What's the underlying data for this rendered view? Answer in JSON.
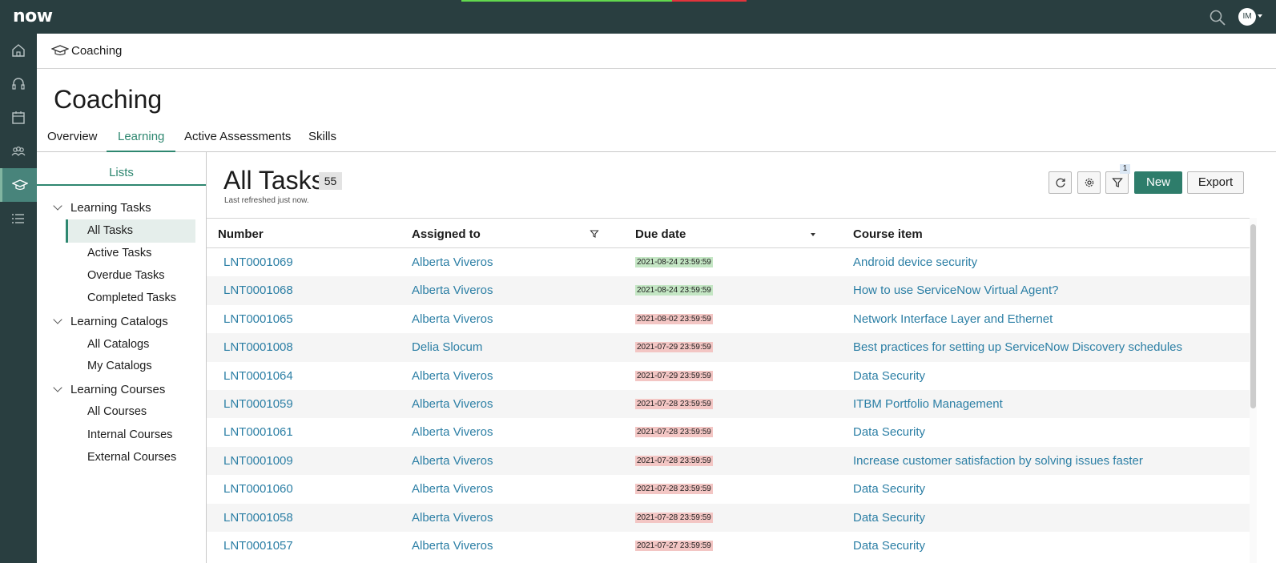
{
  "header": {
    "logo_text": "now",
    "avatar_initials": "IM",
    "progress_colors": {
      "ok": "#62d84e",
      "warn": "#e2343c"
    }
  },
  "rail": {
    "items": [
      {
        "icon": "home-icon"
      },
      {
        "icon": "headset-icon"
      },
      {
        "icon": "calendar-icon"
      },
      {
        "icon": "team-icon"
      },
      {
        "icon": "graduation-cap-icon",
        "active": true
      },
      {
        "icon": "list-icon"
      }
    ]
  },
  "pagebar": {
    "title": "Coaching"
  },
  "page": {
    "title": "Coaching"
  },
  "tabs": [
    {
      "label": "Overview"
    },
    {
      "label": "Learning",
      "active": true
    },
    {
      "label": "Active Assessments"
    },
    {
      "label": "Skills"
    }
  ],
  "sidebar": {
    "header": "Lists",
    "groups": [
      {
        "label": "Learning Tasks",
        "items": [
          "All Tasks",
          "Active Tasks",
          "Overdue Tasks",
          "Completed Tasks"
        ]
      },
      {
        "label": "Learning Catalogs",
        "items": [
          "All Catalogs",
          "My Catalogs"
        ]
      },
      {
        "label": "Learning Courses",
        "items": [
          "All Courses",
          "Internal Courses",
          "External Courses"
        ]
      }
    ],
    "selected": "All Tasks"
  },
  "list": {
    "title": "All Tasks",
    "count": "55",
    "refreshed": "Last refreshed just now.",
    "filter_count": "1",
    "new_label": "New",
    "export_label": "Export",
    "columns": [
      "Number",
      "Assigned to",
      "Due date",
      "Course item"
    ],
    "rows": [
      {
        "number": "LNT0001069",
        "assigned": "Alberta Viveros",
        "due": "2021-08-24 23:59:59",
        "due_status": "green",
        "course": "Android device security"
      },
      {
        "number": "LNT0001068",
        "assigned": "Alberta Viveros",
        "due": "2021-08-24 23:59:59",
        "due_status": "green",
        "course": "How to use ServiceNow Virtual Agent?"
      },
      {
        "number": "LNT0001065",
        "assigned": "Alberta Viveros",
        "due": "2021-08-02 23:59:59",
        "due_status": "red",
        "course": "Network Interface Layer and Ethernet"
      },
      {
        "number": "LNT0001008",
        "assigned": "Delia Slocum",
        "due": "2021-07-29 23:59:59",
        "due_status": "red",
        "course": "Best practices for setting up ServiceNow Discovery schedules"
      },
      {
        "number": "LNT0001064",
        "assigned": "Alberta Viveros",
        "due": "2021-07-29 23:59:59",
        "due_status": "red",
        "course": "Data Security"
      },
      {
        "number": "LNT0001059",
        "assigned": "Alberta Viveros",
        "due": "2021-07-28 23:59:59",
        "due_status": "red",
        "course": "ITBM Portfolio Management"
      },
      {
        "number": "LNT0001061",
        "assigned": "Alberta Viveros",
        "due": "2021-07-28 23:59:59",
        "due_status": "red",
        "course": "Data Security"
      },
      {
        "number": "LNT0001009",
        "assigned": "Alberta Viveros",
        "due": "2021-07-28 23:59:59",
        "due_status": "red",
        "course": "Increase customer satisfaction by solving issues faster"
      },
      {
        "number": "LNT0001060",
        "assigned": "Alberta Viveros",
        "due": "2021-07-28 23:59:59",
        "due_status": "red",
        "course": "Data Security"
      },
      {
        "number": "LNT0001058",
        "assigned": "Alberta Viveros",
        "due": "2021-07-28 23:59:59",
        "due_status": "red",
        "course": "Data Security"
      },
      {
        "number": "LNT0001057",
        "assigned": "Alberta Viveros",
        "due": "2021-07-27 23:59:59",
        "due_status": "red",
        "course": "Data Security"
      }
    ]
  }
}
